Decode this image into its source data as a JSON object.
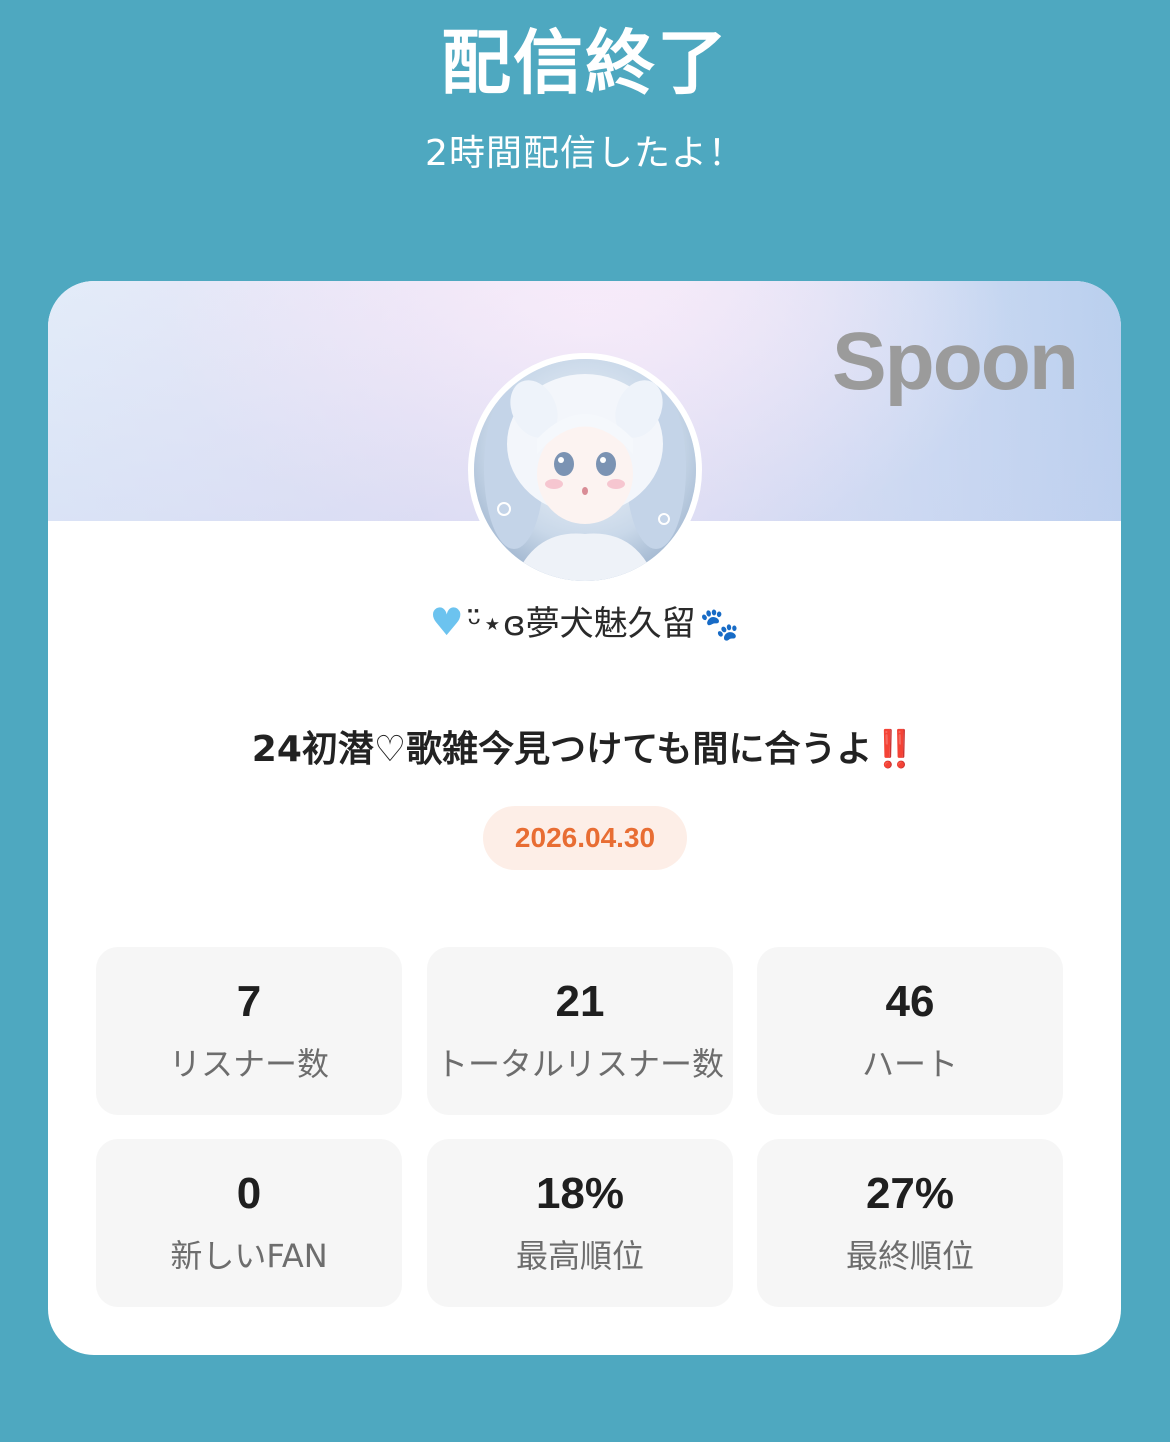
{
  "header": {
    "title": "配信終了",
    "subtitle": "2時間配信したよ！"
  },
  "card": {
    "brand": "Spoon",
    "host": {
      "name": "ᵕ̈⋆ɞ夢犬魅久留"
    },
    "broadcast": {
      "title": "24初潜♡歌雑今見つけても間に合うよ",
      "title_emphasis": "‼️",
      "date": "2026.04.30"
    },
    "stats": [
      {
        "value": "7",
        "label": "リスナー数"
      },
      {
        "value": "21",
        "label": "トータルリスナー数"
      },
      {
        "value": "46",
        "label": "ハート"
      },
      {
        "value": "0",
        "label": "新しいFAN"
      },
      {
        "value": "18%",
        "label": "最高順位"
      },
      {
        "value": "27%",
        "label": "最終順位"
      }
    ]
  },
  "colors": {
    "background": "#4ea8c0",
    "date_text": "#e86d33",
    "date_bg": "#fdeee7",
    "heart": "#6cc3ef",
    "emphasis": "#e2282b"
  }
}
